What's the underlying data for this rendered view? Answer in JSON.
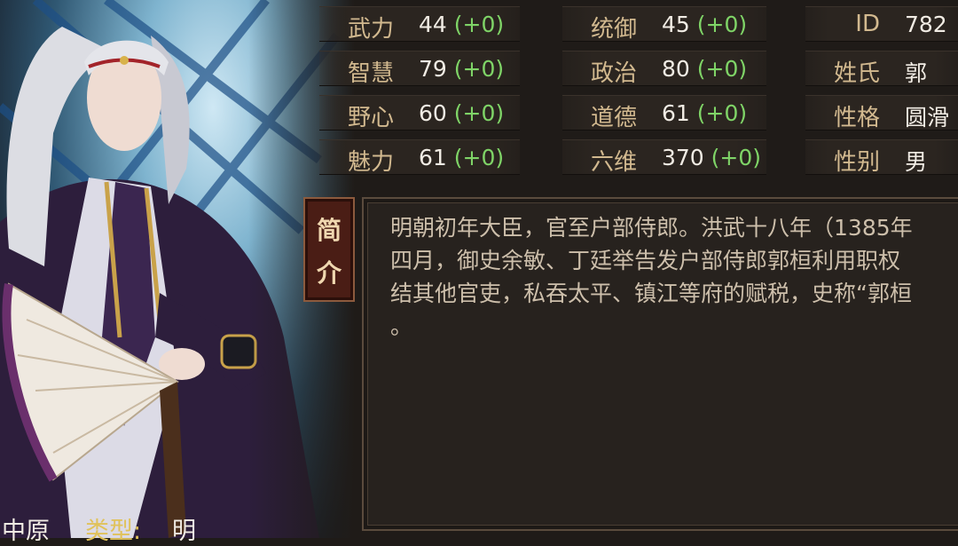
{
  "stats": {
    "wuli": {
      "label": "武力",
      "value": "44",
      "bonus": "(+0)"
    },
    "tongyu": {
      "label": "统御",
      "value": "45",
      "bonus": "(+0)"
    },
    "id": {
      "label": "ID",
      "value": "782"
    },
    "zhihui": {
      "label": "智慧",
      "value": "79",
      "bonus": "(+0)"
    },
    "zhengzhi": {
      "label": "政治",
      "value": "80",
      "bonus": "(+0)"
    },
    "xingshi": {
      "label": "姓氏",
      "value": "郭"
    },
    "yexin": {
      "label": "野心",
      "value": "60",
      "bonus": "(+0)"
    },
    "daode": {
      "label": "道德",
      "value": "61",
      "bonus": "(+0)"
    },
    "xingge": {
      "label": "性格",
      "value": "圆滑"
    },
    "meili": {
      "label": "魅力",
      "value": "61",
      "bonus": "(+0)"
    },
    "liuwei": {
      "label": "六维",
      "value": "370",
      "bonus": "(+0)"
    },
    "xingbie": {
      "label": "性别",
      "value": "男"
    }
  },
  "intro": {
    "tab_char1": "简",
    "tab_char2": "介",
    "text": "明朝初年大臣，官至户部侍郎。洪武十八年（1385年\n四月，御史余敏、丁廷举告发户部侍郎郭桓利用职权\n结其他官吏，私吞太平、镇江等府的赋税，史称“郭桓\n。"
  },
  "footer": {
    "region": "中原",
    "type_label": "类型:",
    "type_value": "明"
  },
  "colors": {
    "label": "#d2b98f",
    "value": "#f1ece4",
    "bonus": "#7fd467",
    "panel": "#27221e"
  }
}
